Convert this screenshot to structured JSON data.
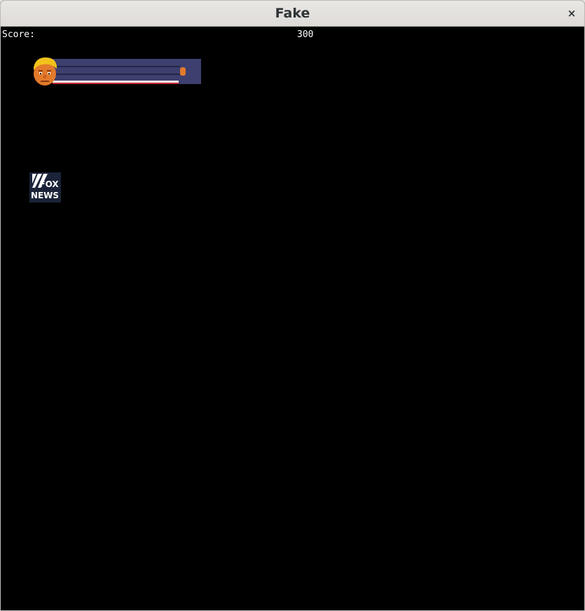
{
  "window": {
    "title": "Fake",
    "close_label": "×"
  },
  "hud": {
    "score_label": "Score:",
    "score_value": "300"
  },
  "sprites": {
    "player_icon": "player-head-icon",
    "enemy_icon": "fox-news-logo",
    "enemy_logo_text_top": "FOX",
    "enemy_logo_text_bottom": "NEWS"
  },
  "colors": {
    "background": "#000000",
    "text": "#ffffff",
    "bar": "#3d3f6e",
    "hair": "#f2c21c",
    "skin": "#e27a2b"
  }
}
